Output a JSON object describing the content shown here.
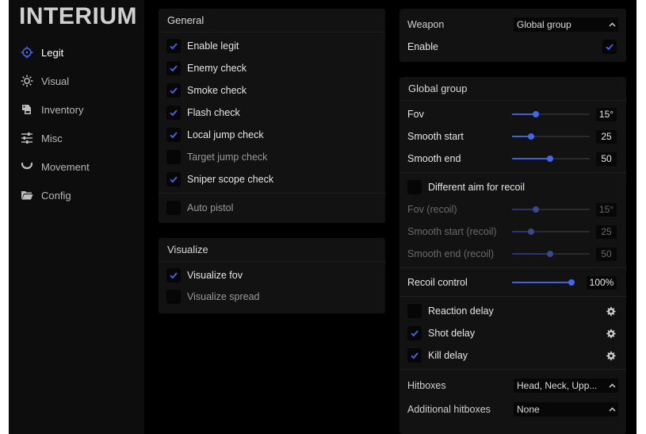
{
  "app": {
    "logo": "INTERIUM",
    "accent": "#3f5ee0"
  },
  "sidebar": {
    "items": [
      {
        "label": "Legit",
        "icon": "crosshair-icon",
        "active": true
      },
      {
        "label": "Visual",
        "icon": "sun-icon",
        "active": false
      },
      {
        "label": "Inventory",
        "icon": "inventory-icon",
        "active": false
      },
      {
        "label": "Misc",
        "icon": "sliders-icon",
        "active": false
      },
      {
        "label": "Movement",
        "icon": "movement-icon",
        "active": false
      },
      {
        "label": "Config",
        "icon": "folder-icon",
        "active": false
      }
    ]
  },
  "general": {
    "title": "General",
    "items": [
      {
        "label": "Enable legit",
        "checked": true
      },
      {
        "label": "Enemy check",
        "checked": true
      },
      {
        "label": "Smoke check",
        "checked": true
      },
      {
        "label": "Flash check",
        "checked": true
      },
      {
        "label": "Local jump check",
        "checked": true
      },
      {
        "label": "Target jump check",
        "checked": false
      },
      {
        "label": "Sniper scope check",
        "checked": true
      },
      {
        "label": "Auto pistol",
        "checked": false
      }
    ]
  },
  "visualize": {
    "title": "Visualize",
    "items": [
      {
        "label": "Visualize fov",
        "checked": true
      },
      {
        "label": "Visualize spread",
        "checked": false
      }
    ]
  },
  "weapon_panel": {
    "weapon_label": "Weapon",
    "weapon_value": "Global group",
    "enable_label": "Enable",
    "enable_checked": true
  },
  "global_group": {
    "title": "Global group",
    "sliders": [
      {
        "label": "Fov",
        "value": "15°",
        "fraction": 0.31
      },
      {
        "label": "Smooth start",
        "value": "25",
        "fraction": 0.24
      },
      {
        "label": "Smooth end",
        "value": "50",
        "fraction": 0.49
      }
    ],
    "different_aim": {
      "label": "Different aim for recoil",
      "checked": false
    },
    "recoil_sliders": [
      {
        "label": "Fov (recoil)",
        "value": "15°",
        "fraction": 0.31
      },
      {
        "label": "Smooth start (recoil)",
        "value": "25",
        "fraction": 0.24
      },
      {
        "label": "Smooth end (recoil)",
        "value": "50",
        "fraction": 0.49
      }
    ],
    "recoil_control": {
      "label": "Recoil control",
      "value": "100%",
      "fraction": 1.0
    },
    "delays": [
      {
        "label": "Reaction delay",
        "checked": false
      },
      {
        "label": "Shot delay",
        "checked": true
      },
      {
        "label": "Kill delay",
        "checked": true
      }
    ],
    "hitboxes": {
      "label": "Hitboxes",
      "value": "Head, Neck, Upp..."
    },
    "additional_hitboxes": {
      "label": "Additional hitboxes",
      "value": "None"
    }
  }
}
